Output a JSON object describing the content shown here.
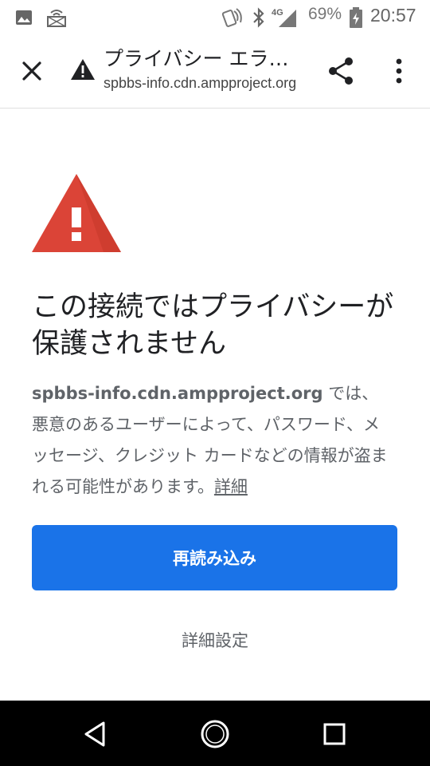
{
  "status_bar": {
    "battery_percent": "69%",
    "time": "20:57",
    "network_label": "4G",
    "icons": [
      "image-icon",
      "wireless-icon",
      "nfc-icon",
      "bluetooth-icon",
      "signal-icon",
      "battery-icon"
    ]
  },
  "toolbar": {
    "title": "プライバシー エラ…",
    "url": "spbbs-info.cdn.ampproject.org",
    "icons": [
      "close-icon",
      "warning-icon",
      "share-icon",
      "more-vert-icon"
    ]
  },
  "content": {
    "heading": "この接続ではプライバシーが保護されません",
    "domain": "spbbs-info.cdn.ampproject.org",
    "message": " では、悪意のあるユーザーによって、パスワード、メッセージ、クレジット カードなどの情報が盗まれる可能性があります。",
    "details_link": "詳細",
    "reload_button": "再読み込み",
    "advanced_button": "詳細設定"
  },
  "colors": {
    "accent": "#1a73e8",
    "warning_red": "#db4437",
    "text_dark": "#202124",
    "text_gray": "#5f6368"
  },
  "nav_bar": {
    "icons": [
      "back-icon",
      "home-icon",
      "recents-icon"
    ]
  }
}
